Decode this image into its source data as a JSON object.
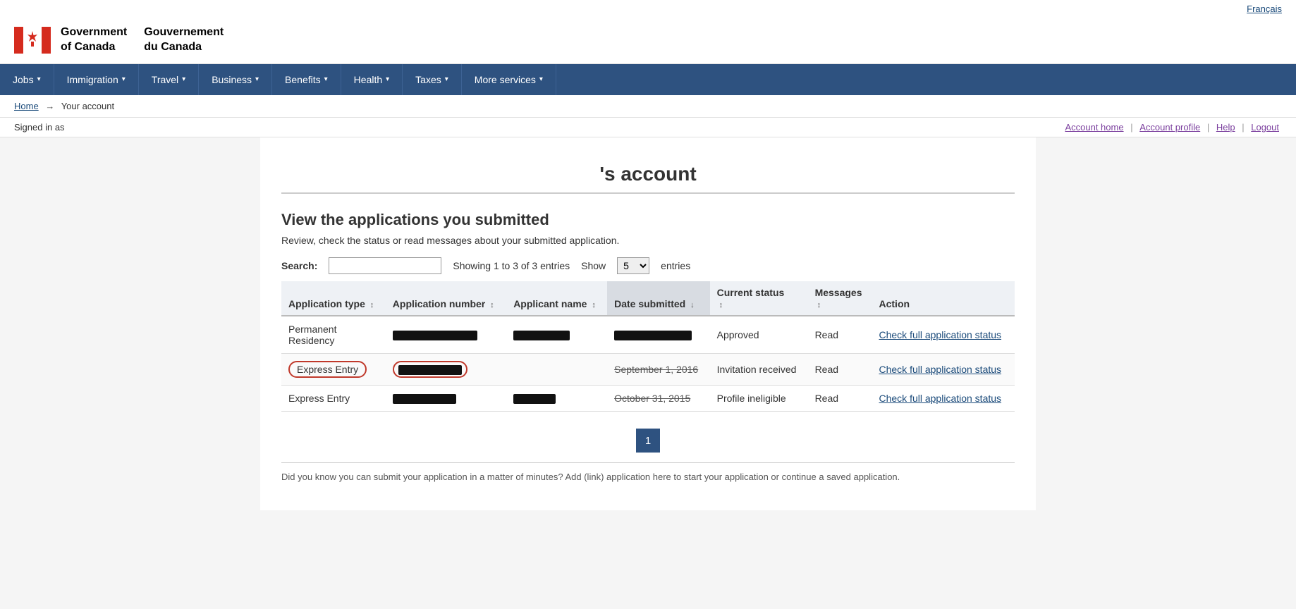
{
  "topbar": {
    "french_link": "Français"
  },
  "header": {
    "gov_name_line1": "Government",
    "gov_name_line2": "of Canada",
    "gov_name_fr_line1": "Gouvernement",
    "gov_name_fr_line2": "du Canada"
  },
  "nav": {
    "items": [
      {
        "label": "Jobs",
        "id": "jobs"
      },
      {
        "label": "Immigration",
        "id": "immigration"
      },
      {
        "label": "Travel",
        "id": "travel"
      },
      {
        "label": "Business",
        "id": "business"
      },
      {
        "label": "Benefits",
        "id": "benefits"
      },
      {
        "label": "Health",
        "id": "health"
      },
      {
        "label": "Taxes",
        "id": "taxes"
      },
      {
        "label": "More services",
        "id": "more-services"
      }
    ]
  },
  "breadcrumb": {
    "home": "Home",
    "arrow": "→",
    "current": "Your account"
  },
  "account_bar": {
    "signed_in_label": "Signed in as",
    "account_home": "Account home",
    "account_profile": "Account profile",
    "help": "Help",
    "logout": "Logout"
  },
  "page": {
    "title": "'s account",
    "section_title": "View the applications you submitted",
    "section_desc": "Review, check the status or read messages about your submitted application.",
    "search_label": "Search:",
    "search_placeholder": "",
    "showing_text": "Showing 1 to 3 of 3 entries",
    "show_label": "Show",
    "show_value": "5",
    "entries_label": "entries"
  },
  "table": {
    "headers": {
      "app_type": "Application type",
      "app_number": "Application number",
      "applicant_name": "Applicant name",
      "date_submitted": "Date submitted",
      "current_status": "Current status",
      "messages": "Messages",
      "action": "Action"
    },
    "rows": [
      {
        "app_type": "Permanent Residency",
        "app_number_redacted": true,
        "app_number_width": 120,
        "applicant_name_redacted": true,
        "applicant_name_width": 80,
        "date_redacted": true,
        "date_width": 110,
        "date_strikethrough": false,
        "status": "Approved",
        "messages": "Read",
        "action": "Check full application status",
        "highlighted": false
      },
      {
        "app_type": "Express Entry",
        "app_number_redacted": true,
        "app_number_width": 100,
        "applicant_name_redacted": false,
        "applicant_name_width": 0,
        "date_redacted": false,
        "date_text": "September 1, 2016",
        "date_strikethrough": true,
        "status": "Invitation received",
        "messages": "Read",
        "action": "Check full application status",
        "highlighted": true
      },
      {
        "app_type": "Express Entry",
        "app_number_redacted": true,
        "app_number_width": 90,
        "applicant_name_redacted": true,
        "applicant_name_width": 60,
        "date_redacted": false,
        "date_text": "October 31, 2015",
        "date_strikethrough": true,
        "status": "Profile ineligible",
        "messages": "Read",
        "action": "Check full application status",
        "highlighted": false
      }
    ]
  },
  "pagination": {
    "current_page": "1"
  },
  "bottom_text": "Did you know you can submit your application in a matter of minutes? Add (link) application here to start your application or continue a saved application."
}
